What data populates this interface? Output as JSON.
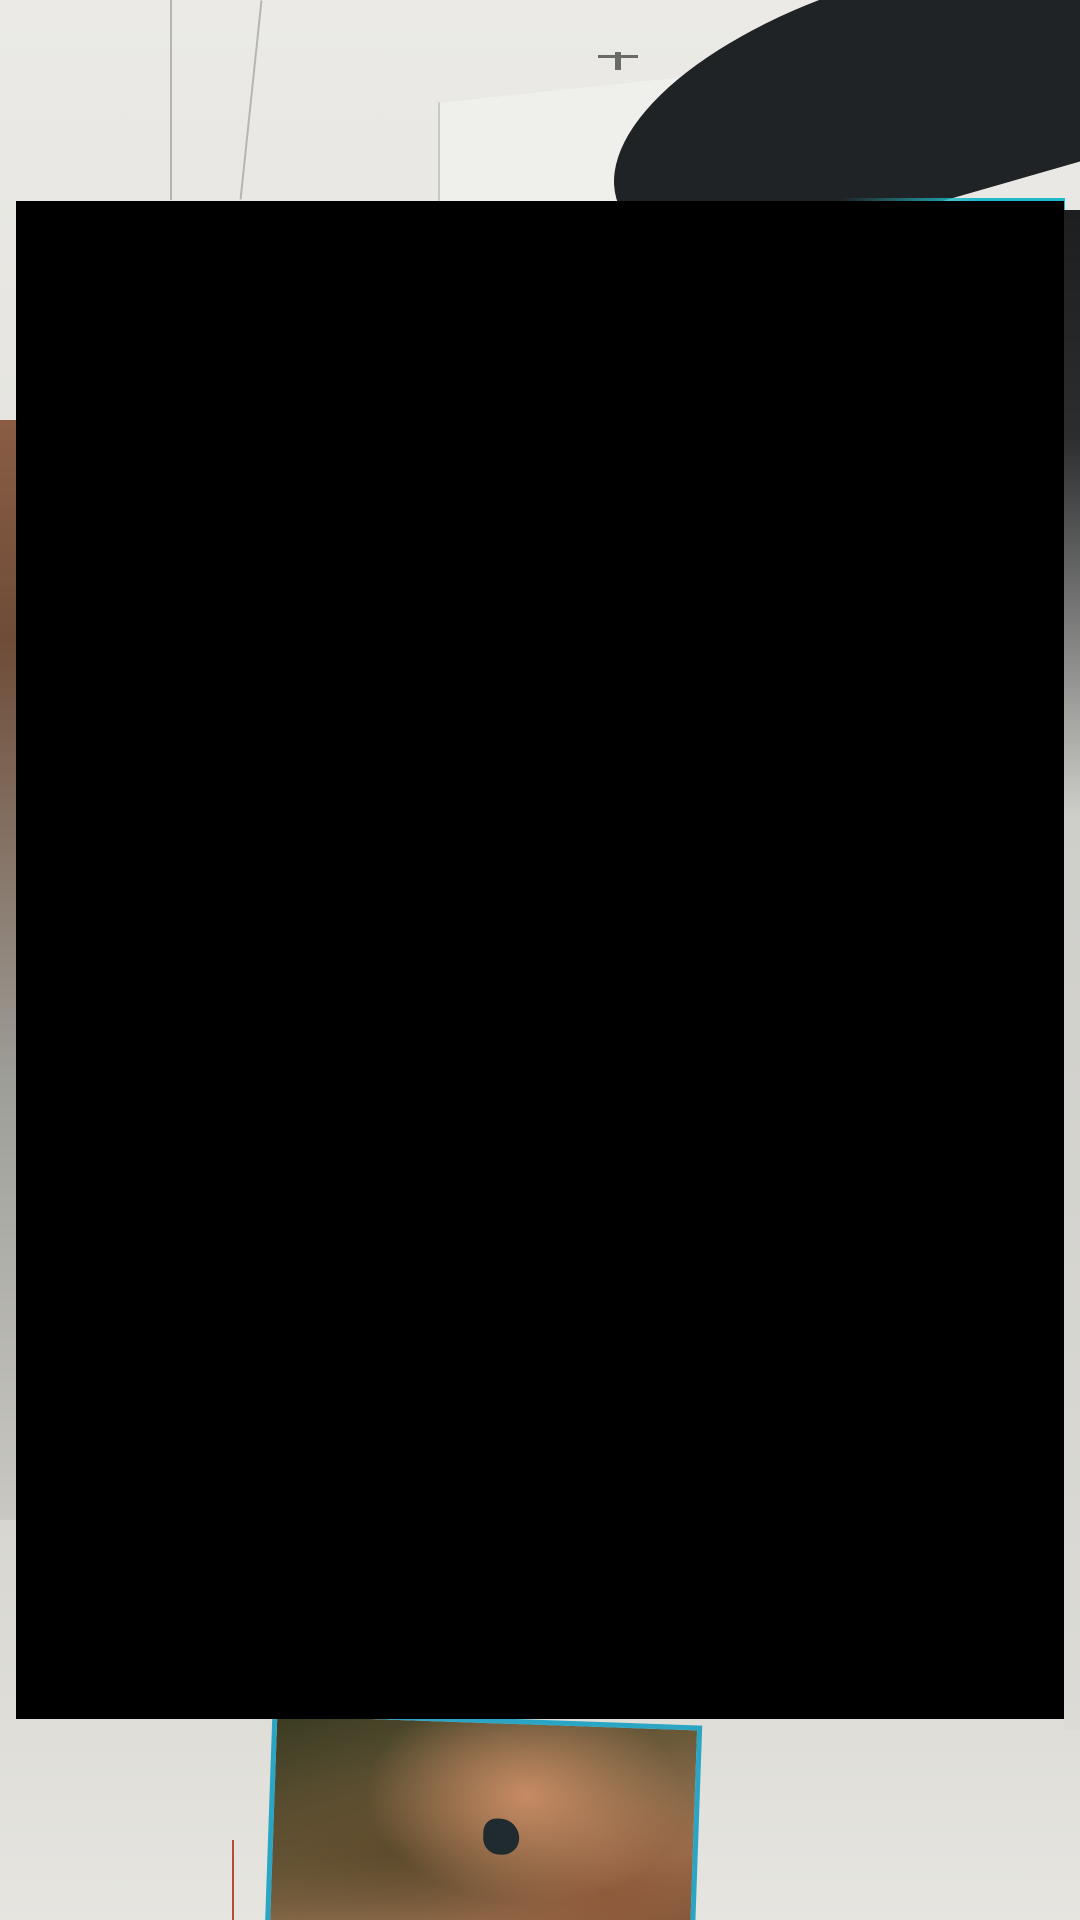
{
  "screen": {
    "background_color": "#d9d8d3"
  },
  "camera_feed": {
    "description_icon": "camera-view-icon"
  },
  "content_area": {
    "color": "#000000"
  },
  "accent": {
    "teal": "#21b9c9",
    "frame": "#2aa6c4"
  }
}
